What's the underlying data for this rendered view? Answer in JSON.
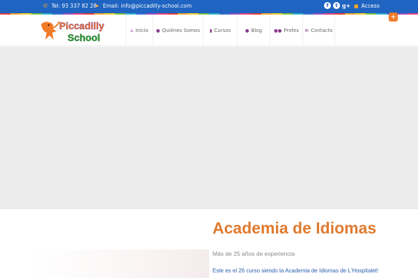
{
  "topbar": {
    "phone": "Tel: 93 337 82 28",
    "email": "Email: info@piccadilly-school.com",
    "social": [
      "f",
      "t",
      "g+"
    ],
    "login": "Acceso"
  },
  "colors": {
    "topbar": "#1f64c1",
    "accent": "#e07b2f",
    "nav_icon": "#8a3a8f",
    "link": "#2a5fae",
    "stripe": [
      "#e63b3b",
      "#f5a72b",
      "#f7d21f",
      "#7cc242",
      "#2fb6c9",
      "#3a6fd1",
      "#9a4fc3",
      "#e6407f"
    ]
  },
  "logo": {
    "line1": "Piccadilly",
    "line2": "School"
  },
  "nav": [
    {
      "label": "Inicio",
      "icon": "home-icon"
    },
    {
      "label": "Quiénes Somos",
      "icon": "user-icon"
    },
    {
      "label": "Cursos",
      "icon": "book-icon"
    },
    {
      "label": "Blog",
      "icon": "user-icon"
    },
    {
      "label": "Profes",
      "icon": "users-icon"
    },
    {
      "label": "Contacto",
      "icon": "envelope-icon"
    }
  ],
  "main": {
    "title": "Academia de Idiomas",
    "subtitle": "Más de 25 años de experiencia",
    "text": "Este es el 26 curso siendo la Academia de Idiomas de L'Hospitalet!"
  }
}
